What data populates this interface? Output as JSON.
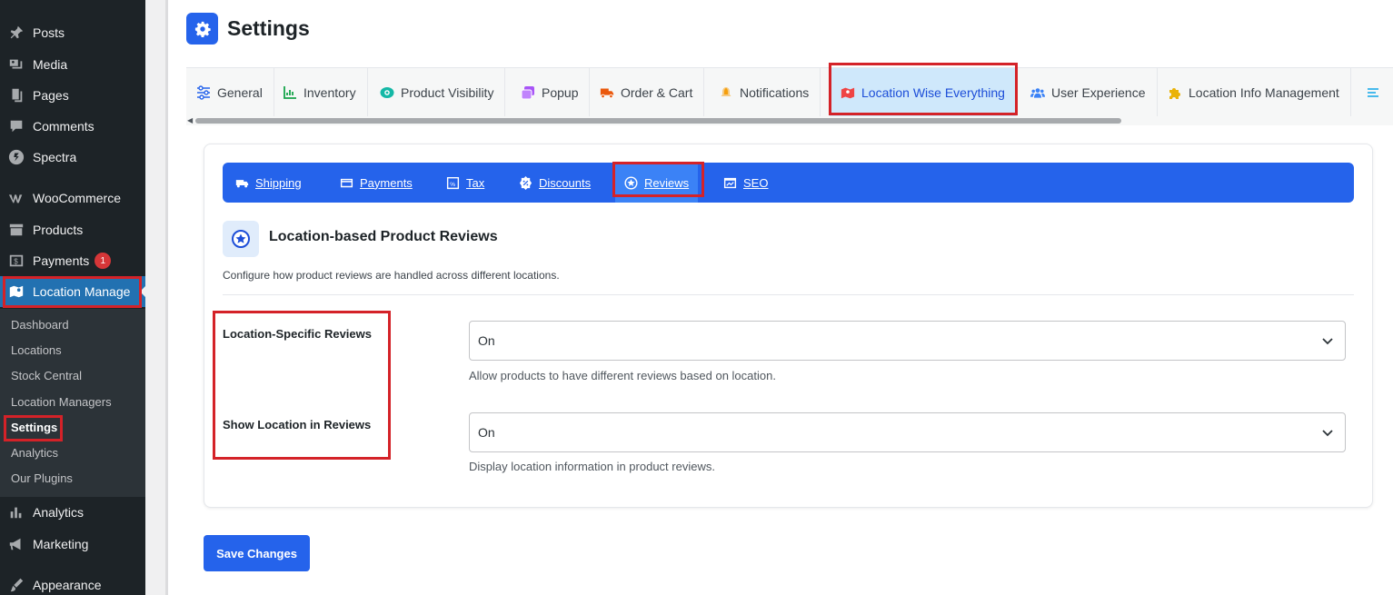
{
  "sidebar": {
    "items": [
      {
        "label": "Posts",
        "icon": "pin-icon"
      },
      {
        "label": "Media",
        "icon": "media-icon"
      },
      {
        "label": "Pages",
        "icon": "pages-icon"
      },
      {
        "label": "Comments",
        "icon": "comment-icon"
      },
      {
        "label": "Spectra",
        "icon": "spectra-icon"
      },
      {
        "label": "WooCommerce",
        "icon": "woocommerce-icon"
      },
      {
        "label": "Products",
        "icon": "archive-icon"
      },
      {
        "label": "Payments",
        "icon": "payments-icon",
        "badge": "1"
      },
      {
        "label": "Location Manage",
        "icon": "map-icon"
      },
      {
        "label": "Analytics",
        "icon": "chart-icon"
      },
      {
        "label": "Marketing",
        "icon": "megaphone-icon"
      },
      {
        "label": "Appearance",
        "icon": "brush-icon"
      }
    ],
    "submenu": [
      "Dashboard",
      "Locations",
      "Stock Central",
      "Location Managers",
      "Settings",
      "Analytics",
      "Our Plugins"
    ]
  },
  "header": {
    "title": "Settings"
  },
  "tabs": [
    "General",
    "Inventory",
    "Product Visibility",
    "Popup",
    "Order & Cart",
    "Notifications",
    "Location Wise Everything",
    "User Experience",
    "Location Info Management"
  ],
  "subtabs": [
    "Shipping",
    "Payments",
    "Tax",
    "Discounts",
    "Reviews",
    "SEO"
  ],
  "section": {
    "title": "Location-based Product Reviews",
    "description": "Configure how product reviews are handled across different locations."
  },
  "fields": [
    {
      "label": "Location-Specific Reviews",
      "value": "On",
      "help": "Allow products to have different reviews based on location."
    },
    {
      "label": "Show Location in Reviews",
      "value": "On",
      "help": "Display location information in product reviews."
    }
  ],
  "save_label": "Save Changes",
  "colors": {
    "accent": "#2563eb",
    "sidebar": "#1d2327",
    "highlight": "#d42228",
    "active_tab": "#cfe8fb"
  }
}
